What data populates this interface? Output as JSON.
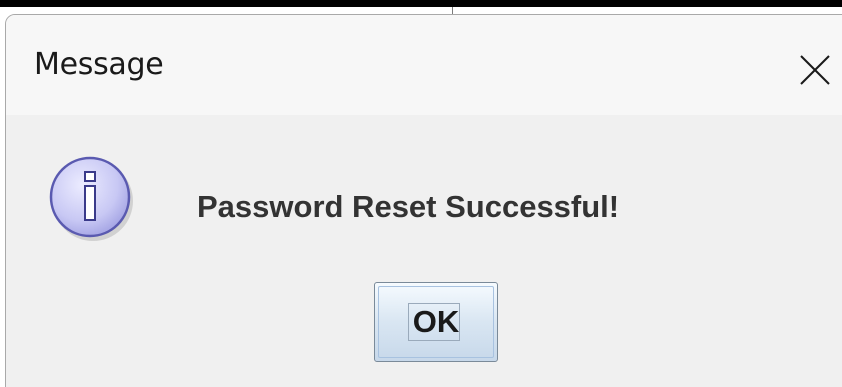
{
  "dialog": {
    "title": "Message",
    "message": "Password Reset Successful!",
    "icon": "info-icon",
    "ok_label": "OK",
    "close_icon": "close-icon"
  },
  "colors": {
    "dialog_background": "#f0f0f0",
    "titlebar_background": "#f7f7f7",
    "message_text": "#333333",
    "info_icon_fill": "#c8c8f4",
    "info_icon_border": "#5a5ab0"
  }
}
